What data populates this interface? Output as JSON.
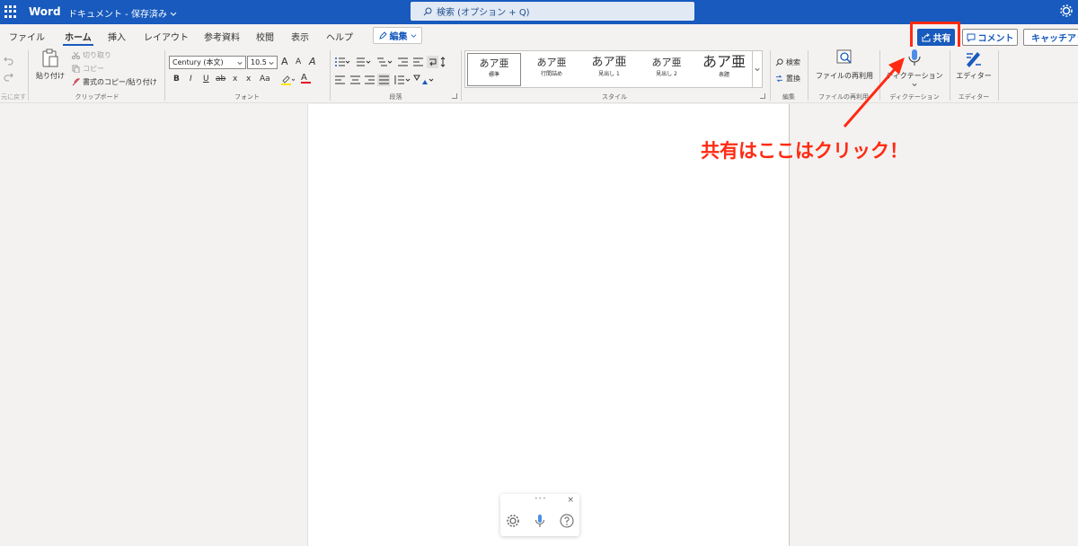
{
  "titlebar": {
    "app_name": "Word",
    "doc_name": "ドキュメント - 保存済み",
    "search_placeholder": "検索 (オプション + Q)",
    "bg_color": "#185abd"
  },
  "tabs": [
    "ファイル",
    "ホーム",
    "挿入",
    "レイアウト",
    "参考資料",
    "校閲",
    "表示",
    "ヘルプ"
  ],
  "active_tab": "ホーム",
  "mode_button": "編集",
  "actions": {
    "share": "共有",
    "comment": "コメント",
    "catchup": "キャッチアップ"
  },
  "ribbon": {
    "undo": {
      "label": "元に戻す"
    },
    "clipboard": {
      "label": "クリップボード",
      "paste": "貼り付け",
      "cut": "切り取り",
      "copy": "コピー",
      "format_painter": "書式のコピー/貼り付け"
    },
    "font": {
      "label": "フォント",
      "font_name": "Century (本文)",
      "font_size": "10.5",
      "grow": "A",
      "shrink": "A",
      "clear": "A",
      "bold": "B",
      "italic": "I",
      "underline": "U",
      "strike": "ab",
      "subscript": "x",
      "superscript": "x",
      "case": "Aa",
      "highlight_color": "#ffe600",
      "font_color": "#e81123",
      "font_color_letter": "A"
    },
    "paragraph": {
      "label": "段落"
    },
    "styles": {
      "label": "スタイル",
      "items": [
        {
          "sample": "あア亜",
          "name": "標準"
        },
        {
          "sample": "あア亜",
          "name": "行間詰め"
        },
        {
          "sample": "あア亜",
          "name": "見出し 1"
        },
        {
          "sample": "あア亜",
          "name": "見出し 2"
        },
        {
          "sample": "あア亜",
          "name": "表題"
        }
      ]
    },
    "editing": {
      "label": "編集",
      "find": "検索",
      "replace": "置換"
    },
    "reuse": {
      "label": "ファイルの再利用",
      "button": "ファイルの再利用"
    },
    "dictation": {
      "label": "ディクテーション",
      "button": "ディクテーション"
    },
    "editor": {
      "label": "エディター",
      "button": "エディター"
    }
  },
  "annotation": {
    "text": "共有はここはクリック！",
    "color": "#ff2a12"
  },
  "dictation_popup": {
    "close": "×"
  }
}
